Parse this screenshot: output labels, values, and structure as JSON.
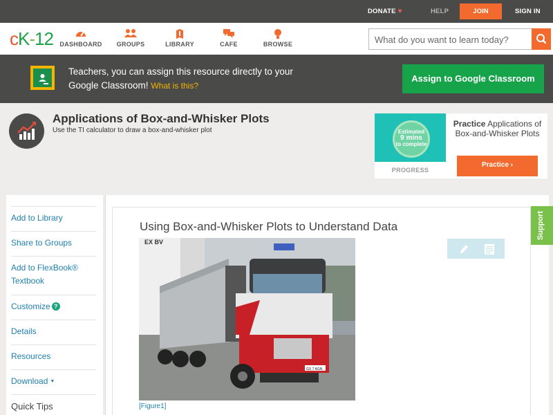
{
  "topbar": {
    "donate": "DONATE",
    "help": "HELP",
    "join": "JOIN",
    "signin": "SIGN IN"
  },
  "logo": {
    "c": "c",
    "k": "K",
    "dash": "-",
    "n": "12"
  },
  "nav": {
    "items": [
      {
        "label": "DASHBOARD",
        "icon": "dashboard-icon"
      },
      {
        "label": "GROUPS",
        "icon": "groups-icon"
      },
      {
        "label": "LIBRARY",
        "icon": "library-icon"
      },
      {
        "label": "CAFE",
        "icon": "cafe-icon"
      },
      {
        "label": "BROWSE",
        "icon": "browse-icon"
      }
    ],
    "search_placeholder": "What do you want to learn today?"
  },
  "banner": {
    "text": "Teachers, you can assign this resource directly to your Google Classroom!",
    "what": "What is this?",
    "button": "Assign to Google Classroom"
  },
  "page": {
    "title": "Applications of Box-and-Whisker Plots",
    "subtitle": "Use the TI calculator to draw a box-and-whisker plot"
  },
  "practice": {
    "estimated": "Estimated",
    "mins": "9 mins",
    "to_complete": "to complete",
    "progress": "PROGRESS",
    "bold": "Practice",
    "rest": "Applications of Box-and-Whisker Plots",
    "button": "Practice"
  },
  "sidebar": {
    "items": [
      {
        "label": "Add to Library"
      },
      {
        "label": "Share to Groups"
      },
      {
        "label": "Add to FlexBook® Textbook"
      },
      {
        "label": "Customize"
      },
      {
        "label": "Details"
      },
      {
        "label": "Resources"
      },
      {
        "label": "Download"
      }
    ],
    "quick_tips": "Quick Tips"
  },
  "content": {
    "title": "Using Box-and-Whisker Plots to Understand Data",
    "figure_caption": "[Figure1]",
    "photo_sign": "EX BV",
    "plate": "GS 7 AGN"
  },
  "support": "Support",
  "colors": {
    "accent": "#f26a2e",
    "dark": "#4a4a49",
    "link": "#1f7fae",
    "green": "#17a34a",
    "support": "#79c14a"
  }
}
